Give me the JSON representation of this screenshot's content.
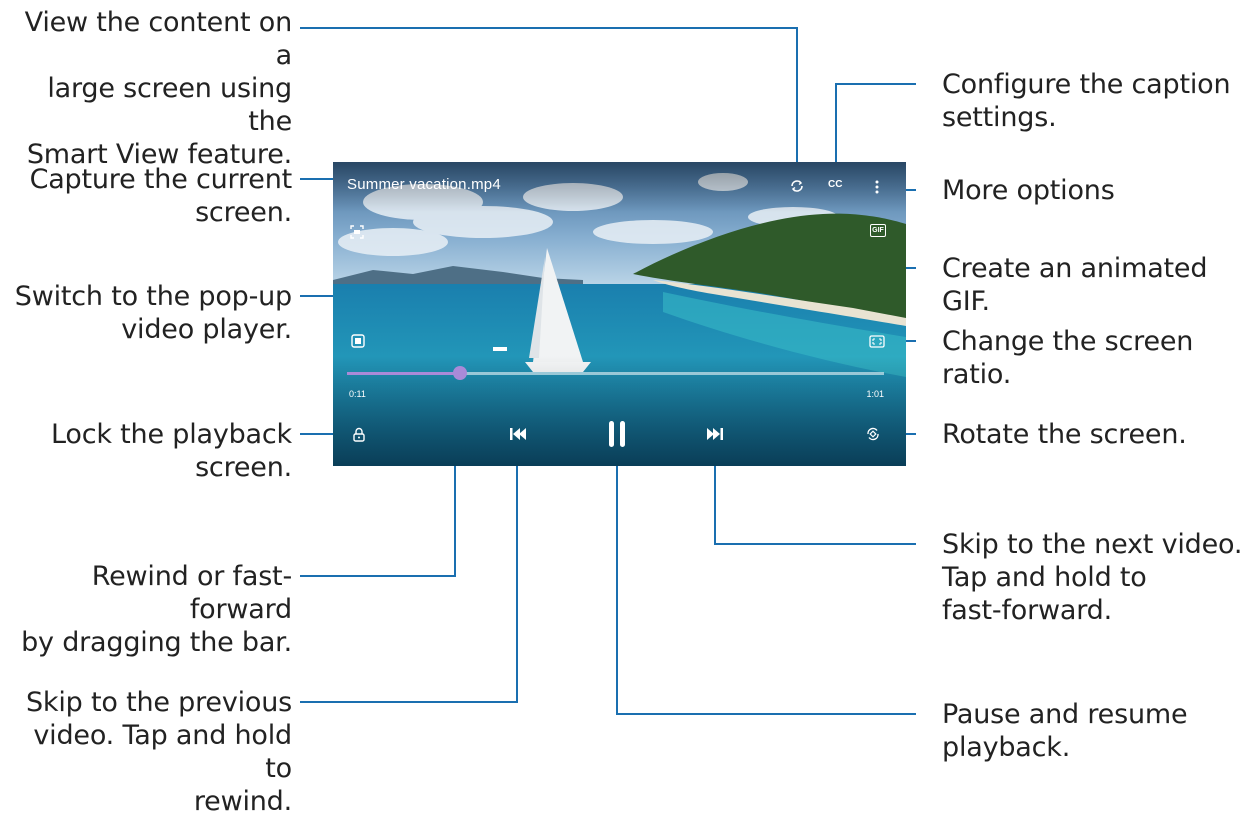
{
  "player": {
    "filename": "Summer vacation.mp4",
    "elapsed": "0:11",
    "duration": "1:01",
    "cc_label": "CC",
    "gif_label": "GIF",
    "progress_fraction": 0.21
  },
  "annotations": {
    "smart_view": "View the content on a\nlarge screen using the\nSmart View feature.",
    "capture": "Capture the current\nscreen.",
    "popup": "Switch to the pop-up\nvideo player.",
    "lock": "Lock the playback\nscreen.",
    "seek": "Rewind or fast-forward\nby dragging the bar.",
    "previous": "Skip to the previous\nvideo. Tap and hold to\nrewind.",
    "caption": "Configure the caption\nsettings.",
    "more": "More options",
    "gif": "Create an animated GIF.",
    "ratio": "Change the screen ratio.",
    "rotate": "Rotate the screen.",
    "next": "Skip to the next video.\nTap and hold to\nfast-forward.",
    "pause": "Pause and resume\nplayback."
  },
  "colors": {
    "leader_line": "#1a6fb0",
    "seek_accent": "#a98ad8",
    "annotation_text": "#222222"
  }
}
